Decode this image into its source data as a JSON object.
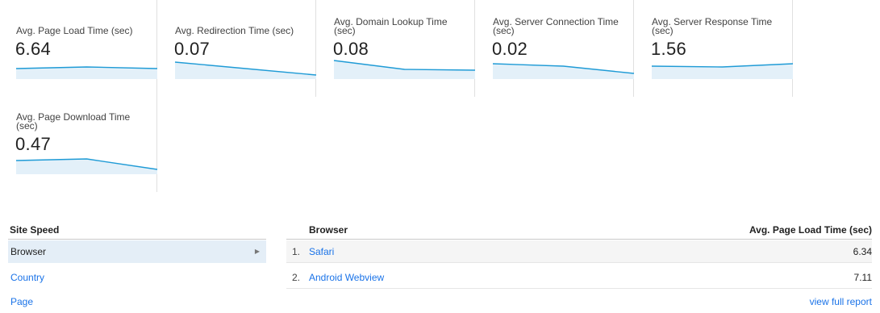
{
  "metrics": [
    {
      "label": "Avg. Page Load Time (sec)",
      "value": "6.64",
      "trend": [
        0.45,
        0.55,
        0.45
      ]
    },
    {
      "label": "Avg. Redirection Time (sec)",
      "value": "0.07",
      "trend": [
        0.85,
        0.45,
        0.05
      ]
    },
    {
      "label": "Avg. Domain Lookup Time (sec)",
      "value": "0.08",
      "trend": [
        0.95,
        0.4,
        0.35
      ]
    },
    {
      "label": "Avg. Server Connection Time (sec)",
      "value": "0.02",
      "trend": [
        0.75,
        0.6,
        0.15
      ]
    },
    {
      "label": "Avg. Server Response Time (sec)",
      "value": "1.56",
      "trend": [
        0.6,
        0.55,
        0.75
      ]
    },
    {
      "label": "Avg. Page Download Time (sec)",
      "value": "0.47",
      "trend": [
        0.65,
        0.75,
        0.1
      ]
    }
  ],
  "site_speed": {
    "header": "Site Speed",
    "items": [
      {
        "label": "Browser",
        "active": true
      },
      {
        "label": "Country",
        "active": false
      },
      {
        "label": "Page",
        "active": false
      }
    ]
  },
  "table": {
    "col_browser": "Browser",
    "col_metric": "Avg. Page Load Time (sec)",
    "rows": [
      {
        "index": "1.",
        "name": "Safari",
        "value": "6.34"
      },
      {
        "index": "2.",
        "name": "Android Webview",
        "value": "7.11"
      }
    ],
    "full_report": "view full report"
  },
  "colors": {
    "accent": "#1f9bd6",
    "link": "#1a73e8",
    "sparkline_fill": "#e3f0f9"
  }
}
